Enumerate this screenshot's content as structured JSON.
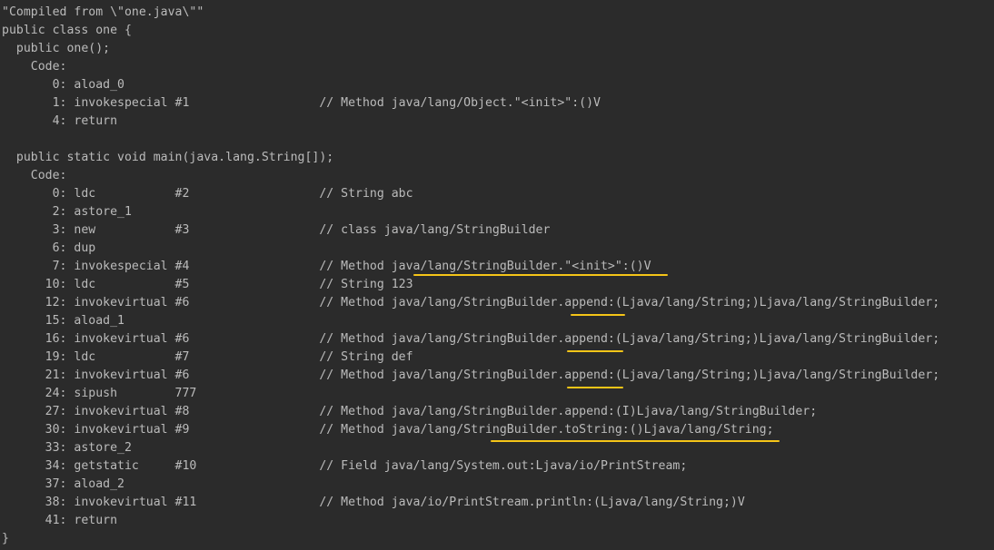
{
  "lines": [
    "\"Compiled from \\\"one.java\\\"\"",
    "public class one {",
    "  public one();",
    "    Code:",
    "       0: aload_0",
    "       1: invokespecial #1                  // Method java/lang/Object.\"<init>\":()V",
    "       4: return",
    "",
    "  public static void main(java.lang.String[]);",
    "    Code:",
    "       0: ldc           #2                  // String abc",
    "       2: astore_1",
    "       3: new           #3                  // class java/lang/StringBuilder",
    "       6: dup",
    "       7: invokespecial #4                  // Method java/lang/StringBuilder.\"<init>\":()V",
    "      10: ldc           #5                  // String 123",
    "      12: invokevirtual #6                  // Method java/lang/StringBuilder.append:(Ljava/lang/String;)Ljava/lang/StringBuilder;",
    "      15: aload_1",
    "      16: invokevirtual #6                  // Method java/lang/StringBuilder.append:(Ljava/lang/String;)Ljava/lang/StringBuilder;",
    "      19: ldc           #7                  // String def",
    "      21: invokevirtual #6                  // Method java/lang/StringBuilder.append:(Ljava/lang/String;)Ljava/lang/StringBuilder;",
    "      24: sipush        777",
    "      27: invokevirtual #8                  // Method java/lang/StringBuilder.append:(I)Ljava/lang/StringBuilder;",
    "      30: invokevirtual #9                  // Method java/lang/StringBuilder.toString:()Ljava/lang/String;",
    "      33: astore_2",
    "      34: getstatic     #10                 // Field java/lang/System.out:Ljava/io/PrintStream;",
    "      37: aload_2",
    "      38: invokevirtual #11                 // Method java/io/PrintStream.println:(Ljava/lang/String;)V",
    "      41: return",
    "}"
  ],
  "colors": {
    "background": "#2b2b2b",
    "text": "#bbbbbb",
    "highlight_underline": "#f5c518"
  }
}
